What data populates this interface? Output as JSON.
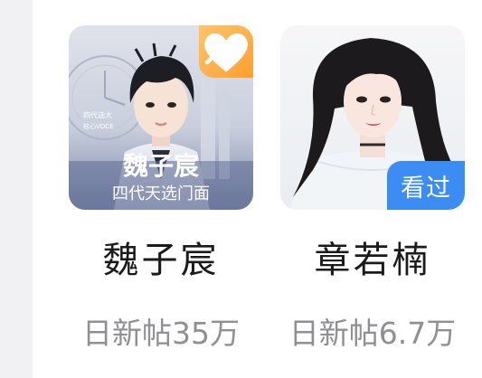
{
  "cards": [
    {
      "name": "魏子宸",
      "stat": "日新帖35万",
      "poster_text_1": "魏子宸",
      "poster_text_2": "四代天选门面",
      "poster_small_1": "四代选大",
      "poster_small_2": "核心VOCE",
      "badge_icon": "heart-icon",
      "badge_color": "#ffa83a"
    },
    {
      "name": "章若楠",
      "stat": "日新帖6.7万",
      "badge_label": "看过",
      "badge_color": "#3b8cf3"
    }
  ]
}
